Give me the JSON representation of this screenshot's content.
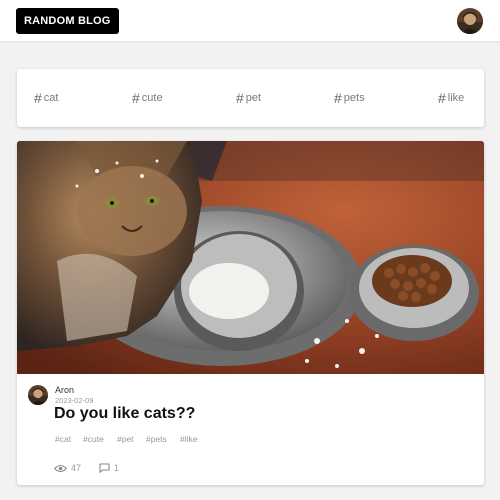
{
  "header": {
    "brand": "RANDOM BLOG",
    "avatar_icon": "user-avatar"
  },
  "tag_bar": {
    "icon": "hash-icon",
    "tags": [
      "cat",
      "cute",
      "pet",
      "pets",
      "like"
    ]
  },
  "post": {
    "image_icon": "cat-photo",
    "author": "Aron",
    "date": "2023-02-09",
    "title": "Do you like cats??",
    "tags": [
      "#cat",
      "#cute",
      "#pet",
      "#pets",
      "#like"
    ],
    "views": "47",
    "views_icon": "eye-icon",
    "comments": "1",
    "comments_icon": "comment-icon"
  },
  "colors": {
    "brand_bg": "#000000",
    "card_bg": "#ffffff",
    "page_bg": "#f2f2f2",
    "muted_text": "#9a9a9a"
  }
}
